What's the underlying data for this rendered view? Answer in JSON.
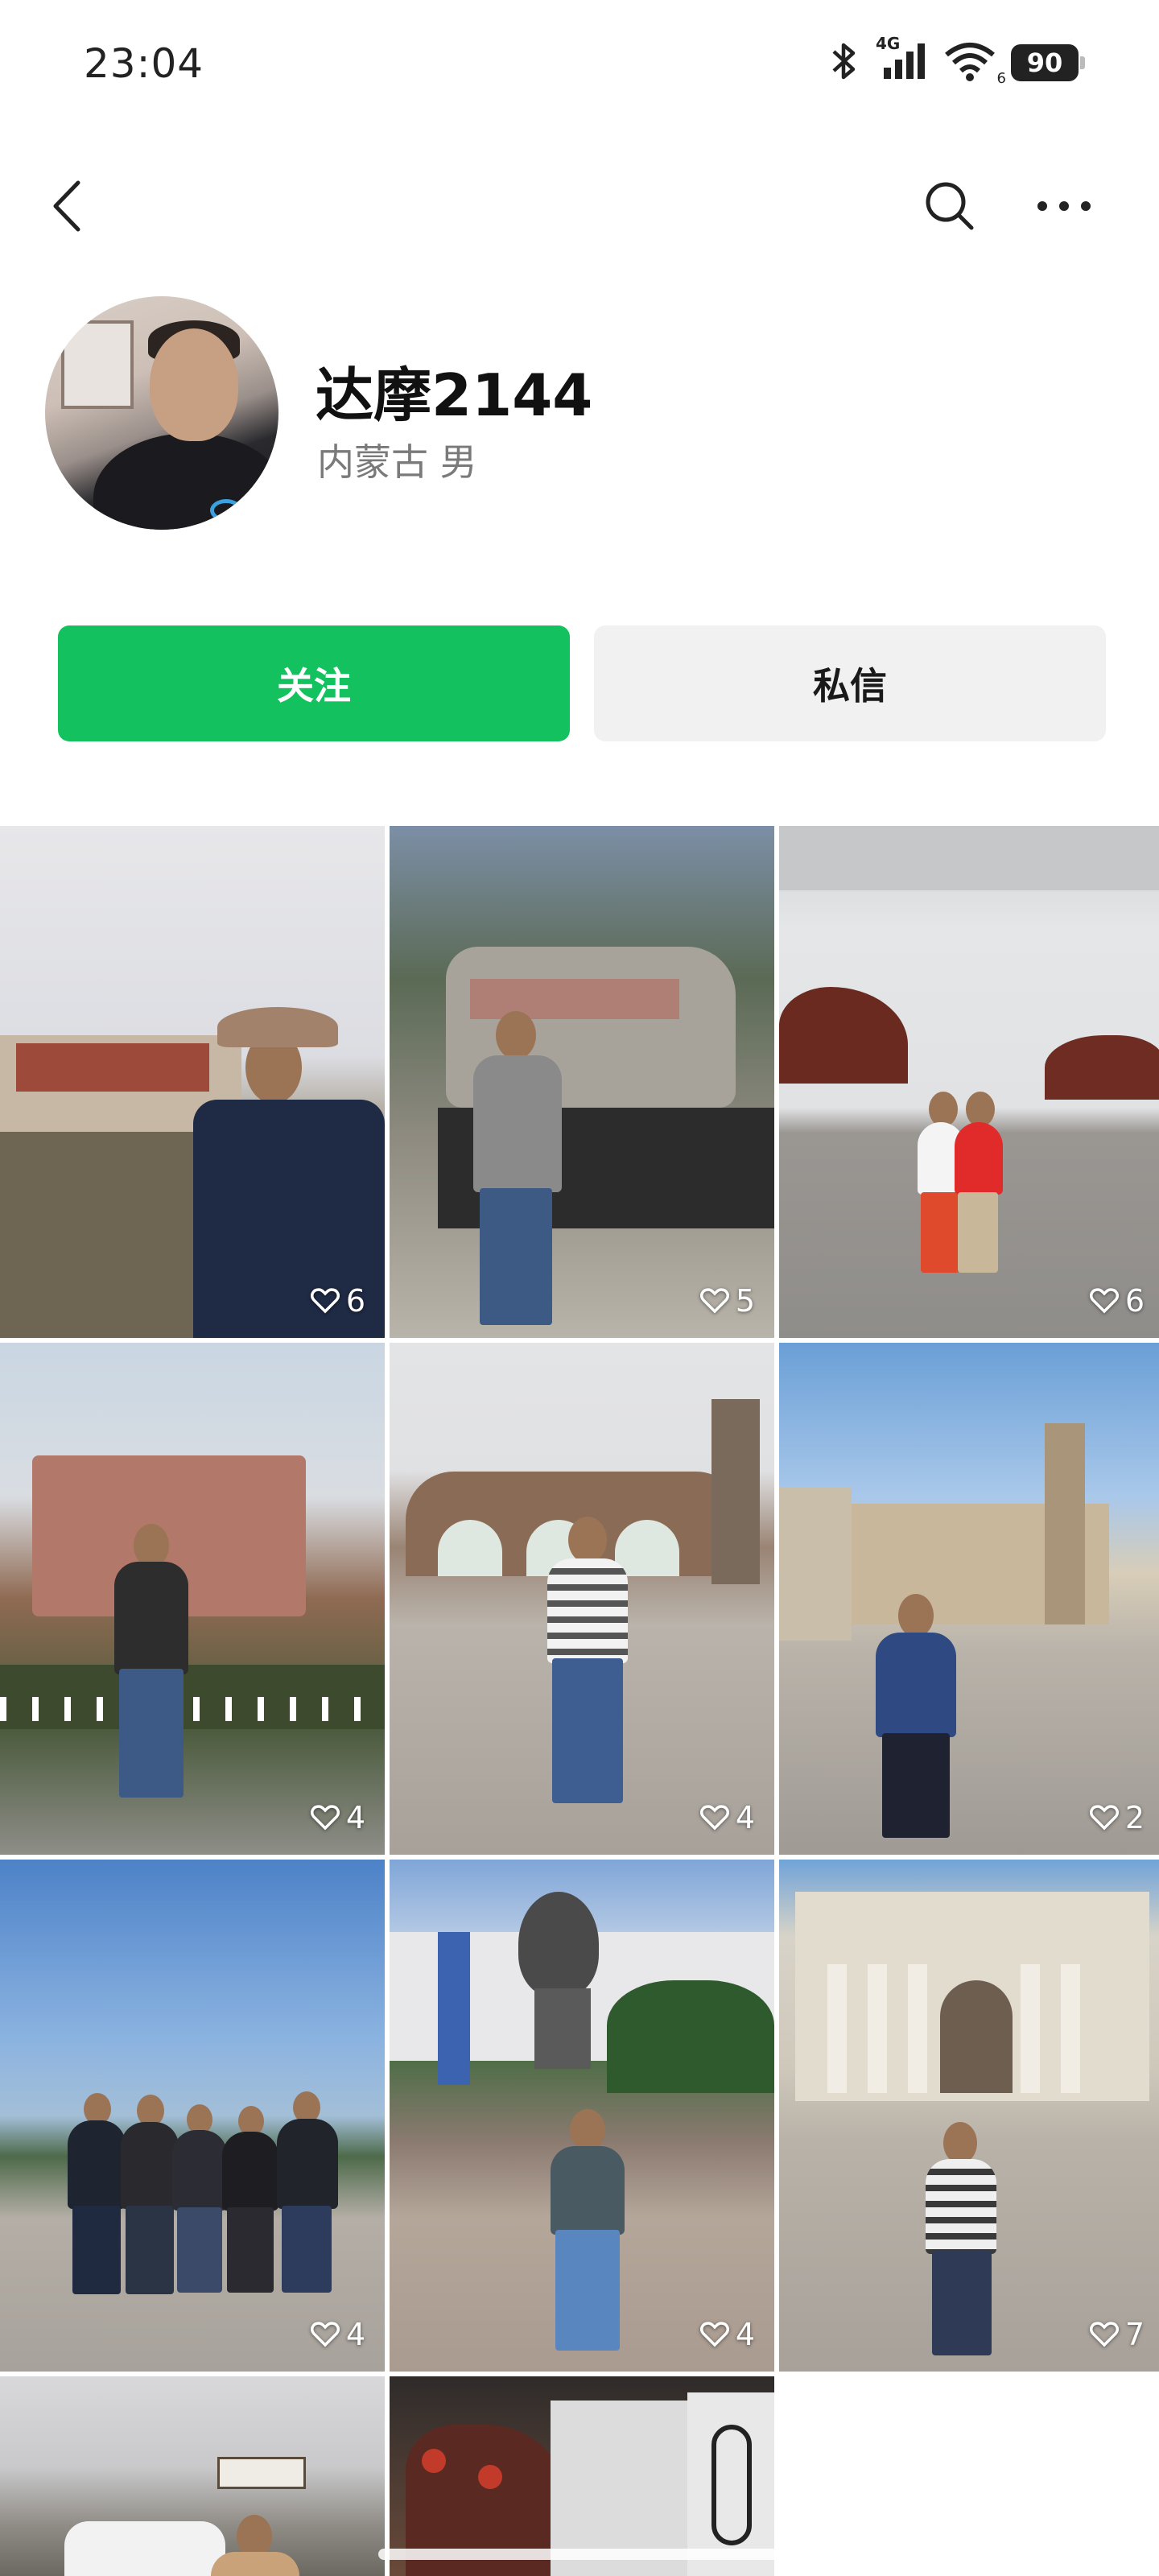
{
  "status_bar": {
    "time": "23:04",
    "network": "4G",
    "wifi_sub": "6",
    "battery": "90"
  },
  "nav": {
    "back_icon": "chevron-left-icon",
    "search_icon": "search-icon",
    "more_icon": "more-horizontal-icon"
  },
  "profile": {
    "name": "达摩2144",
    "info": "内蒙古 男"
  },
  "actions": {
    "follow_label": "关注",
    "message_label": "私信",
    "follow_color": "#13c15e"
  },
  "posts": [
    {
      "likes": "6"
    },
    {
      "likes": "5"
    },
    {
      "likes": "6"
    },
    {
      "likes": "4"
    },
    {
      "likes": "4"
    },
    {
      "likes": "2"
    },
    {
      "likes": "4"
    },
    {
      "likes": "4"
    },
    {
      "likes": "7"
    },
    {
      "likes": ""
    },
    {
      "likes": ""
    }
  ]
}
